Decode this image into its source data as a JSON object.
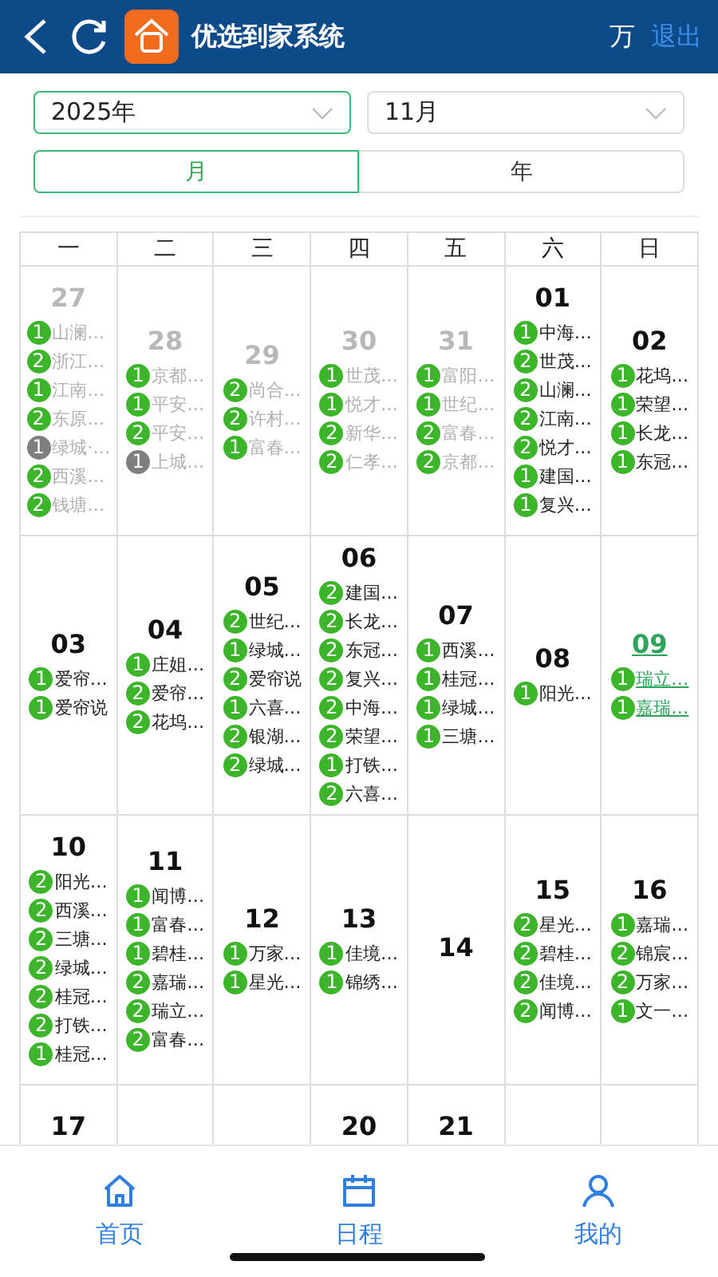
{
  "header": {
    "title": "优选到家系统",
    "user": "万",
    "logout": "退出"
  },
  "selects": [
    {
      "value": "2025年",
      "active": true
    },
    {
      "value": "11月",
      "active": false
    }
  ],
  "view_tabs": [
    {
      "label": "月",
      "selected": true
    },
    {
      "label": "年",
      "selected": false
    }
  ],
  "weekdays": [
    "一",
    "二",
    "三",
    "四",
    "五",
    "六",
    "日"
  ],
  "weeks": [
    [
      {
        "kind": "day",
        "day": "27",
        "muted": true,
        "today": false,
        "events": [
          {
            "count": "1",
            "label": "山澜…",
            "color": "#3db52a"
          },
          {
            "count": "2",
            "label": "浙江…",
            "color": "#3db52a"
          },
          {
            "count": "1",
            "label": "江南…",
            "color": "#3db52a"
          },
          {
            "count": "2",
            "label": "东原…",
            "color": "#3db52a"
          },
          {
            "count": "1",
            "label": "绿城·…",
            "color": "#7f7f7f"
          },
          {
            "count": "2",
            "label": "西溪…",
            "color": "#3db52a"
          },
          {
            "count": "2",
            "label": "钱塘…",
            "color": "#3db52a"
          }
        ]
      },
      {
        "kind": "day",
        "day": "28",
        "muted": true,
        "today": false,
        "events": [
          {
            "count": "1",
            "label": "京都…",
            "color": "#3db52a"
          },
          {
            "count": "1",
            "label": "平安…",
            "color": "#3db52a"
          },
          {
            "count": "2",
            "label": "平安…",
            "color": "#3db52a"
          },
          {
            "count": "1",
            "label": "上城…",
            "color": "#7f7f7f"
          }
        ]
      },
      {
        "kind": "day",
        "day": "29",
        "muted": true,
        "today": false,
        "events": [
          {
            "count": "2",
            "label": "尚合…",
            "color": "#3db52a"
          },
          {
            "count": "2",
            "label": "许村…",
            "color": "#3db52a"
          },
          {
            "count": "1",
            "label": "富春…",
            "color": "#3db52a"
          }
        ]
      },
      {
        "kind": "day",
        "day": "30",
        "muted": true,
        "today": false,
        "events": [
          {
            "count": "1",
            "label": "世茂…",
            "color": "#3db52a"
          },
          {
            "count": "1",
            "label": "悦才…",
            "color": "#3db52a"
          },
          {
            "count": "2",
            "label": "新华…",
            "color": "#3db52a"
          },
          {
            "count": "2",
            "label": "仁孝…",
            "color": "#3db52a"
          }
        ]
      },
      {
        "kind": "day",
        "day": "31",
        "muted": true,
        "today": false,
        "events": [
          {
            "count": "1",
            "label": "富阳…",
            "color": "#3db52a"
          },
          {
            "count": "1",
            "label": "世纪…",
            "color": "#3db52a"
          },
          {
            "count": "2",
            "label": "富春…",
            "color": "#3db52a"
          },
          {
            "count": "2",
            "label": "京都…",
            "color": "#3db52a"
          }
        ]
      },
      {
        "kind": "day",
        "day": "01",
        "muted": false,
        "today": false,
        "events": [
          {
            "count": "1",
            "label": "中海…",
            "color": "#3db52a"
          },
          {
            "count": "2",
            "label": "世茂…",
            "color": "#3db52a"
          },
          {
            "count": "2",
            "label": "山澜…",
            "color": "#3db52a"
          },
          {
            "count": "2",
            "label": "江南…",
            "color": "#3db52a"
          },
          {
            "count": "2",
            "label": "悦才…",
            "color": "#3db52a"
          },
          {
            "count": "1",
            "label": "建国…",
            "color": "#3db52a"
          },
          {
            "count": "1",
            "label": "复兴…",
            "color": "#3db52a"
          }
        ]
      },
      {
        "kind": "day",
        "day": "02",
        "muted": false,
        "today": false,
        "events": [
          {
            "count": "1",
            "label": "花坞…",
            "color": "#3db52a"
          },
          {
            "count": "1",
            "label": "荣望…",
            "color": "#3db52a"
          },
          {
            "count": "1",
            "label": "长龙…",
            "color": "#3db52a"
          },
          {
            "count": "1",
            "label": "东冠…",
            "color": "#3db52a"
          }
        ]
      }
    ],
    [
      {
        "kind": "day",
        "day": "03",
        "muted": false,
        "today": false,
        "events": [
          {
            "count": "1",
            "label": "爱帘…",
            "color": "#3db52a"
          },
          {
            "count": "1",
            "label": "爱帘说",
            "color": "#3db52a"
          }
        ]
      },
      {
        "kind": "day",
        "day": "04",
        "muted": false,
        "today": false,
        "events": [
          {
            "count": "1",
            "label": "庄姐…",
            "color": "#3db52a"
          },
          {
            "count": "2",
            "label": "爱帘…",
            "color": "#3db52a"
          },
          {
            "count": "2",
            "label": "花坞…",
            "color": "#3db52a"
          }
        ]
      },
      {
        "kind": "day",
        "day": "05",
        "muted": false,
        "today": false,
        "events": [
          {
            "count": "2",
            "label": "世纪…",
            "color": "#3db52a"
          },
          {
            "count": "1",
            "label": "绿城…",
            "color": "#3db52a"
          },
          {
            "count": "2",
            "label": "爱帘说",
            "color": "#3db52a"
          },
          {
            "count": "1",
            "label": "六喜…",
            "color": "#3db52a"
          },
          {
            "count": "2",
            "label": "银湖…",
            "color": "#3db52a"
          },
          {
            "count": "2",
            "label": "绿城…",
            "color": "#3db52a"
          }
        ]
      },
      {
        "kind": "day",
        "day": "06",
        "muted": false,
        "today": false,
        "events": [
          {
            "count": "2",
            "label": "建国…",
            "color": "#3db52a"
          },
          {
            "count": "2",
            "label": "长龙…",
            "color": "#3db52a"
          },
          {
            "count": "2",
            "label": "东冠…",
            "color": "#3db52a"
          },
          {
            "count": "2",
            "label": "复兴…",
            "color": "#3db52a"
          },
          {
            "count": "2",
            "label": "中海…",
            "color": "#3db52a"
          },
          {
            "count": "2",
            "label": "荣望…",
            "color": "#3db52a"
          },
          {
            "count": "1",
            "label": "打铁…",
            "color": "#3db52a"
          },
          {
            "count": "2",
            "label": "六喜…",
            "color": "#3db52a"
          }
        ]
      },
      {
        "kind": "day",
        "day": "07",
        "muted": false,
        "today": false,
        "events": [
          {
            "count": "1",
            "label": "西溪…",
            "color": "#3db52a"
          },
          {
            "count": "1",
            "label": "桂冠…",
            "color": "#3db52a"
          },
          {
            "count": "1",
            "label": "绿城…",
            "color": "#3db52a"
          },
          {
            "count": "1",
            "label": "三塘…",
            "color": "#3db52a"
          }
        ]
      },
      {
        "kind": "day",
        "day": "08",
        "muted": false,
        "today": false,
        "events": [
          {
            "count": "1",
            "label": "阳光…",
            "color": "#3db52a"
          }
        ]
      },
      {
        "kind": "day",
        "day": "09",
        "muted": false,
        "today": true,
        "events": [
          {
            "count": "1",
            "label": "瑞立…",
            "color": "#3db52a"
          },
          {
            "count": "1",
            "label": "嘉瑞…",
            "color": "#3db52a"
          }
        ]
      }
    ],
    [
      {
        "kind": "day",
        "day": "10",
        "muted": false,
        "today": false,
        "events": [
          {
            "count": "2",
            "label": "阳光…",
            "color": "#3db52a"
          },
          {
            "count": "2",
            "label": "西溪…",
            "color": "#3db52a"
          },
          {
            "count": "2",
            "label": "三塘…",
            "color": "#3db52a"
          },
          {
            "count": "2",
            "label": "绿城…",
            "color": "#3db52a"
          },
          {
            "count": "2",
            "label": "桂冠…",
            "color": "#3db52a"
          },
          {
            "count": "2",
            "label": "打铁…",
            "color": "#3db52a"
          },
          {
            "count": "1",
            "label": "桂冠…",
            "color": "#3db52a"
          }
        ]
      },
      {
        "kind": "day",
        "day": "11",
        "muted": false,
        "today": false,
        "events": [
          {
            "count": "1",
            "label": "闻博…",
            "color": "#3db52a"
          },
          {
            "count": "1",
            "label": "富春…",
            "color": "#3db52a"
          },
          {
            "count": "1",
            "label": "碧桂…",
            "color": "#3db52a"
          },
          {
            "count": "2",
            "label": "嘉瑞…",
            "color": "#3db52a"
          },
          {
            "count": "2",
            "label": "瑞立…",
            "color": "#3db52a"
          },
          {
            "count": "2",
            "label": "富春…",
            "color": "#3db52a"
          }
        ]
      },
      {
        "kind": "day",
        "day": "12",
        "muted": false,
        "today": false,
        "events": [
          {
            "count": "1",
            "label": "万家…",
            "color": "#3db52a"
          },
          {
            "count": "1",
            "label": "星光…",
            "color": "#3db52a"
          }
        ]
      },
      {
        "kind": "day",
        "day": "13",
        "muted": false,
        "today": false,
        "events": [
          {
            "count": "1",
            "label": "佳境…",
            "color": "#3db52a"
          },
          {
            "count": "1",
            "label": "锦绣…",
            "color": "#3db52a"
          }
        ]
      },
      {
        "kind": "day",
        "day": "14",
        "muted": false,
        "today": false
      },
      {
        "kind": "day",
        "day": "15",
        "muted": false,
        "today": false,
        "events": [
          {
            "count": "2",
            "label": "星光…",
            "color": "#3db52a"
          },
          {
            "count": "2",
            "label": "碧桂…",
            "color": "#3db52a"
          },
          {
            "count": "2",
            "label": "佳境…",
            "color": "#3db52a"
          },
          {
            "count": "2",
            "label": "闻博…",
            "color": "#3db52a"
          }
        ]
      },
      {
        "kind": "day",
        "day": "16",
        "muted": false,
        "today": false,
        "events": [
          {
            "count": "1",
            "label": "嘉瑞…",
            "color": "#3db52a"
          },
          {
            "count": "2",
            "label": "锦宸…",
            "color": "#3db52a"
          },
          {
            "count": "2",
            "label": "万家…",
            "color": "#3db52a"
          },
          {
            "count": "1",
            "label": "文一…",
            "color": "#3db52a"
          }
        ]
      }
    ],
    [
      {
        "kind": "day",
        "day": "17"
      },
      {
        "kind": "blank"
      },
      {
        "kind": "blank"
      },
      {
        "kind": "day",
        "day": "20"
      },
      {
        "kind": "day",
        "day": "21"
      },
      {
        "kind": "blank"
      },
      {
        "kind": "blank"
      }
    ]
  ],
  "nav": [
    {
      "label": "首页",
      "kind": "home"
    },
    {
      "label": "日程",
      "kind": "calendar"
    },
    {
      "label": "我的",
      "kind": "user"
    }
  ]
}
